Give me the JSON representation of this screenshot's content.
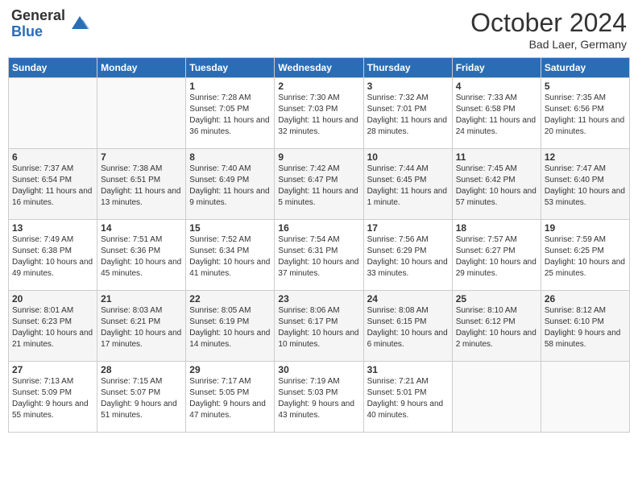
{
  "header": {
    "logo_general": "General",
    "logo_blue": "Blue",
    "month_title": "October 2024",
    "location": "Bad Laer, Germany"
  },
  "days_of_week": [
    "Sunday",
    "Monday",
    "Tuesday",
    "Wednesday",
    "Thursday",
    "Friday",
    "Saturday"
  ],
  "weeks": [
    [
      {
        "day": "",
        "details": ""
      },
      {
        "day": "",
        "details": ""
      },
      {
        "day": "1",
        "details": "Sunrise: 7:28 AM\nSunset: 7:05 PM\nDaylight: 11 hours and 36 minutes."
      },
      {
        "day": "2",
        "details": "Sunrise: 7:30 AM\nSunset: 7:03 PM\nDaylight: 11 hours and 32 minutes."
      },
      {
        "day": "3",
        "details": "Sunrise: 7:32 AM\nSunset: 7:01 PM\nDaylight: 11 hours and 28 minutes."
      },
      {
        "day": "4",
        "details": "Sunrise: 7:33 AM\nSunset: 6:58 PM\nDaylight: 11 hours and 24 minutes."
      },
      {
        "day": "5",
        "details": "Sunrise: 7:35 AM\nSunset: 6:56 PM\nDaylight: 11 hours and 20 minutes."
      }
    ],
    [
      {
        "day": "6",
        "details": "Sunrise: 7:37 AM\nSunset: 6:54 PM\nDaylight: 11 hours and 16 minutes."
      },
      {
        "day": "7",
        "details": "Sunrise: 7:38 AM\nSunset: 6:51 PM\nDaylight: 11 hours and 13 minutes."
      },
      {
        "day": "8",
        "details": "Sunrise: 7:40 AM\nSunset: 6:49 PM\nDaylight: 11 hours and 9 minutes."
      },
      {
        "day": "9",
        "details": "Sunrise: 7:42 AM\nSunset: 6:47 PM\nDaylight: 11 hours and 5 minutes."
      },
      {
        "day": "10",
        "details": "Sunrise: 7:44 AM\nSunset: 6:45 PM\nDaylight: 11 hours and 1 minute."
      },
      {
        "day": "11",
        "details": "Sunrise: 7:45 AM\nSunset: 6:42 PM\nDaylight: 10 hours and 57 minutes."
      },
      {
        "day": "12",
        "details": "Sunrise: 7:47 AM\nSunset: 6:40 PM\nDaylight: 10 hours and 53 minutes."
      }
    ],
    [
      {
        "day": "13",
        "details": "Sunrise: 7:49 AM\nSunset: 6:38 PM\nDaylight: 10 hours and 49 minutes."
      },
      {
        "day": "14",
        "details": "Sunrise: 7:51 AM\nSunset: 6:36 PM\nDaylight: 10 hours and 45 minutes."
      },
      {
        "day": "15",
        "details": "Sunrise: 7:52 AM\nSunset: 6:34 PM\nDaylight: 10 hours and 41 minutes."
      },
      {
        "day": "16",
        "details": "Sunrise: 7:54 AM\nSunset: 6:31 PM\nDaylight: 10 hours and 37 minutes."
      },
      {
        "day": "17",
        "details": "Sunrise: 7:56 AM\nSunset: 6:29 PM\nDaylight: 10 hours and 33 minutes."
      },
      {
        "day": "18",
        "details": "Sunrise: 7:57 AM\nSunset: 6:27 PM\nDaylight: 10 hours and 29 minutes."
      },
      {
        "day": "19",
        "details": "Sunrise: 7:59 AM\nSunset: 6:25 PM\nDaylight: 10 hours and 25 minutes."
      }
    ],
    [
      {
        "day": "20",
        "details": "Sunrise: 8:01 AM\nSunset: 6:23 PM\nDaylight: 10 hours and 21 minutes."
      },
      {
        "day": "21",
        "details": "Sunrise: 8:03 AM\nSunset: 6:21 PM\nDaylight: 10 hours and 17 minutes."
      },
      {
        "day": "22",
        "details": "Sunrise: 8:05 AM\nSunset: 6:19 PM\nDaylight: 10 hours and 14 minutes."
      },
      {
        "day": "23",
        "details": "Sunrise: 8:06 AM\nSunset: 6:17 PM\nDaylight: 10 hours and 10 minutes."
      },
      {
        "day": "24",
        "details": "Sunrise: 8:08 AM\nSunset: 6:15 PM\nDaylight: 10 hours and 6 minutes."
      },
      {
        "day": "25",
        "details": "Sunrise: 8:10 AM\nSunset: 6:12 PM\nDaylight: 10 hours and 2 minutes."
      },
      {
        "day": "26",
        "details": "Sunrise: 8:12 AM\nSunset: 6:10 PM\nDaylight: 9 hours and 58 minutes."
      }
    ],
    [
      {
        "day": "27",
        "details": "Sunrise: 7:13 AM\nSunset: 5:09 PM\nDaylight: 9 hours and 55 minutes."
      },
      {
        "day": "28",
        "details": "Sunrise: 7:15 AM\nSunset: 5:07 PM\nDaylight: 9 hours and 51 minutes."
      },
      {
        "day": "29",
        "details": "Sunrise: 7:17 AM\nSunset: 5:05 PM\nDaylight: 9 hours and 47 minutes."
      },
      {
        "day": "30",
        "details": "Sunrise: 7:19 AM\nSunset: 5:03 PM\nDaylight: 9 hours and 43 minutes."
      },
      {
        "day": "31",
        "details": "Sunrise: 7:21 AM\nSunset: 5:01 PM\nDaylight: 9 hours and 40 minutes."
      },
      {
        "day": "",
        "details": ""
      },
      {
        "day": "",
        "details": ""
      }
    ]
  ]
}
